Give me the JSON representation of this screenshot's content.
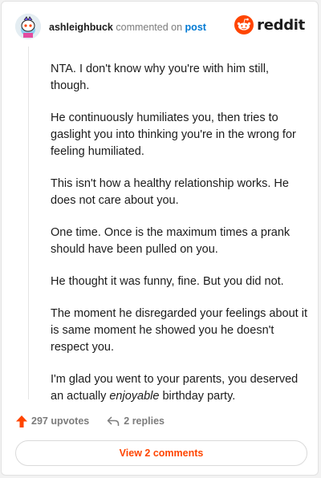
{
  "header": {
    "username": "ashleighbuck",
    "action_text": "commented on",
    "post_link": "post",
    "logo_text": "reddit"
  },
  "comment": {
    "paragraphs": [
      "NTA. I don't know why you're with him still, though.",
      "He continuously humiliates you, then tries to gaslight you into thinking you're in the wrong for feeling humiliated.",
      "This isn't how a healthy relationship works. He does not care about you.",
      "One time. Once is the maximum times a prank should have been pulled on you.",
      "He thought it was funny, fine. But you did not.",
      "The moment he disregarded your feelings about it is same moment he showed you he doesn't respect you."
    ],
    "last_paragraph": {
      "before": "I'm glad you went to your parents, you deserved an actually ",
      "emphasis": "enjoyable",
      "after": " birthday party."
    }
  },
  "actions": {
    "upvotes": "297 upvotes",
    "replies": "2 replies"
  },
  "view_button": "View 2 comments",
  "colors": {
    "accent": "#ff4500",
    "link": "#0079d3",
    "muted": "#7c7c7c"
  },
  "icons": {
    "upvote": "arrow-up-icon",
    "reply": "reply-arrow-icon",
    "logo": "reddit-snoo-icon"
  }
}
